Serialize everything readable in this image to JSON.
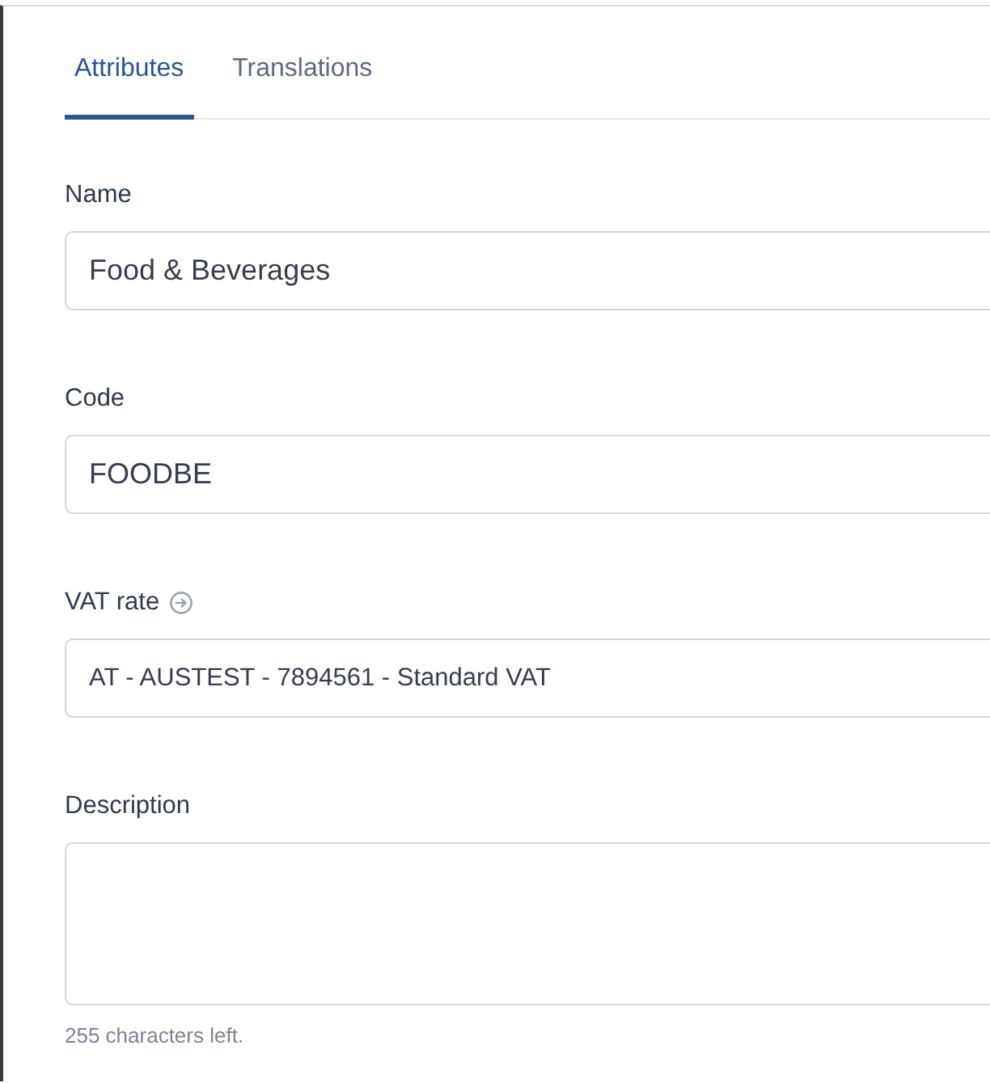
{
  "tabs": [
    {
      "label": "Attributes",
      "selected": true
    },
    {
      "label": "Translations",
      "selected": false
    }
  ],
  "fields": [
    {
      "kind": "input",
      "label": "Name",
      "value": "Food & Beverages",
      "has_icon": false
    },
    {
      "kind": "input",
      "label": "Code",
      "value": "FOODBE",
      "has_icon": false
    },
    {
      "kind": "select",
      "label": "VAT rate",
      "value": "AT - AUSTEST - 7894561 - Standard VAT",
      "has_icon": true
    },
    {
      "kind": "textarea",
      "label": "Description",
      "has_icon": false,
      "hint": "255 characters left."
    }
  ]
}
